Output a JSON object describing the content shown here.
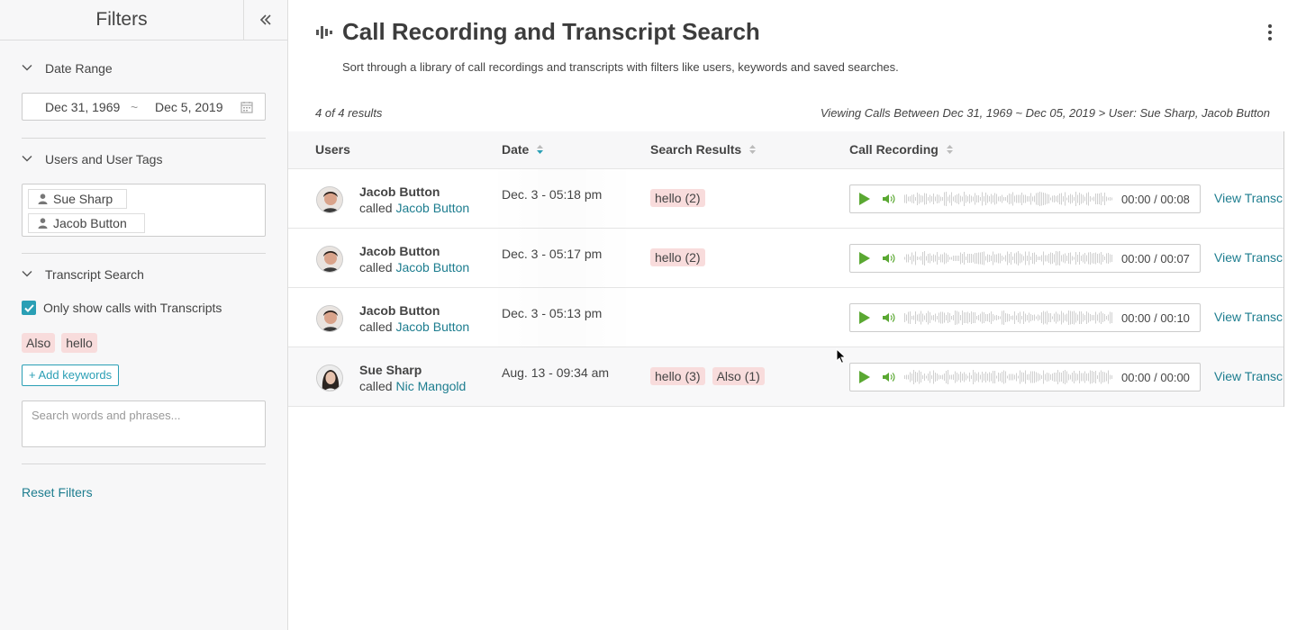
{
  "sidebar": {
    "title": "Filters",
    "sections": {
      "date_range": "Date Range",
      "users": "Users and User Tags",
      "transcript": "Transcript Search"
    },
    "date_from": "Dec 31, 1969",
    "date_sep": "~",
    "date_to": "Dec 5, 2019",
    "user_tags": [
      "Sue Sharp",
      "Jacob Button"
    ],
    "only_transcripts_label": "Only show calls with Transcripts",
    "only_transcripts_checked": true,
    "keywords": [
      "Also",
      "hello"
    ],
    "add_keywords": "+ Add keywords",
    "search_placeholder": "Search words and phrases...",
    "reset": "Reset Filters"
  },
  "header": {
    "title": "Call Recording and Transcript Search",
    "description": "Sort through a library of call recordings and transcripts with filters like users, keywords and saved searches.",
    "result_count": "4 of 4 results",
    "viewing": "Viewing Calls Between Dec 31, 1969 ~ Dec 05, 2019 > User: Sue Sharp, Jacob Button"
  },
  "table": {
    "columns": [
      "Users",
      "Date",
      "Search Results",
      "Call Recording"
    ],
    "called_prefix": "called",
    "view_link": "View Transcript",
    "rows": [
      {
        "user": "Jacob Button",
        "called": "Jacob Button",
        "date": "Dec. 3 - 05:18 pm",
        "results": [
          "hello (2)"
        ],
        "time": "00:00 / 00:08"
      },
      {
        "user": "Jacob Button",
        "called": "Jacob Button",
        "date": "Dec. 3 - 05:17 pm",
        "results": [
          "hello (2)"
        ],
        "time": "00:00 / 00:07"
      },
      {
        "user": "Jacob Button",
        "called": "Jacob Button",
        "date": "Dec. 3 - 05:13 pm",
        "results": [],
        "time": "00:00 / 00:10"
      },
      {
        "user": "Sue Sharp",
        "called": "Nic Mangold",
        "date": "Aug. 13 - 09:34 am",
        "results": [
          "hello (3)",
          "Also (1)"
        ],
        "time": "00:00 / 00:00"
      }
    ]
  },
  "colors": {
    "accent": "#2a9fb5",
    "link": "#1d7d8f",
    "chip": "#f8dcdc",
    "play": "#5aa832"
  }
}
